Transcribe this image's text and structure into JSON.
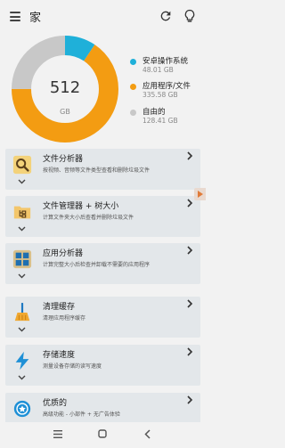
{
  "header": {
    "title": "家"
  },
  "storage": {
    "total": "512",
    "unit": "GB",
    "legend": [
      {
        "label": "安卓操作系统",
        "size": "48.01 GB",
        "value": 48.01,
        "color": "#1fb0d9"
      },
      {
        "label": "应用程序/文件",
        "size": "335.58 GB",
        "value": 335.58,
        "color": "#f39c12"
      },
      {
        "label": "自由的",
        "size": "128.41 GB",
        "value": 128.41,
        "color": "#c8c8c8"
      }
    ]
  },
  "cards": [
    {
      "title": "文件分析器",
      "desc": "按视频、音频等文件类型查看和删除垃圾文件",
      "icon": "file-search-icon"
    },
    {
      "title": "文件管理器 + 树大小",
      "desc": "计算文件夹大小后查看并删除垃圾文件",
      "icon": "folder-tree-icon"
    },
    {
      "title": "应用分析器",
      "desc": "计算完整大小后检查并卸载不需要的应用程序",
      "icon": "app-grid-icon"
    },
    {
      "title": "清理缓存",
      "desc": "清理应用程序缓存",
      "icon": "broom-icon"
    },
    {
      "title": "存储速度",
      "desc": "测量设备存储的读写速度",
      "icon": "lightning-icon"
    },
    {
      "title": "优质的",
      "desc": "高级功能 - 小部件 + 无广告体验",
      "icon": "premium-badge-icon"
    }
  ]
}
